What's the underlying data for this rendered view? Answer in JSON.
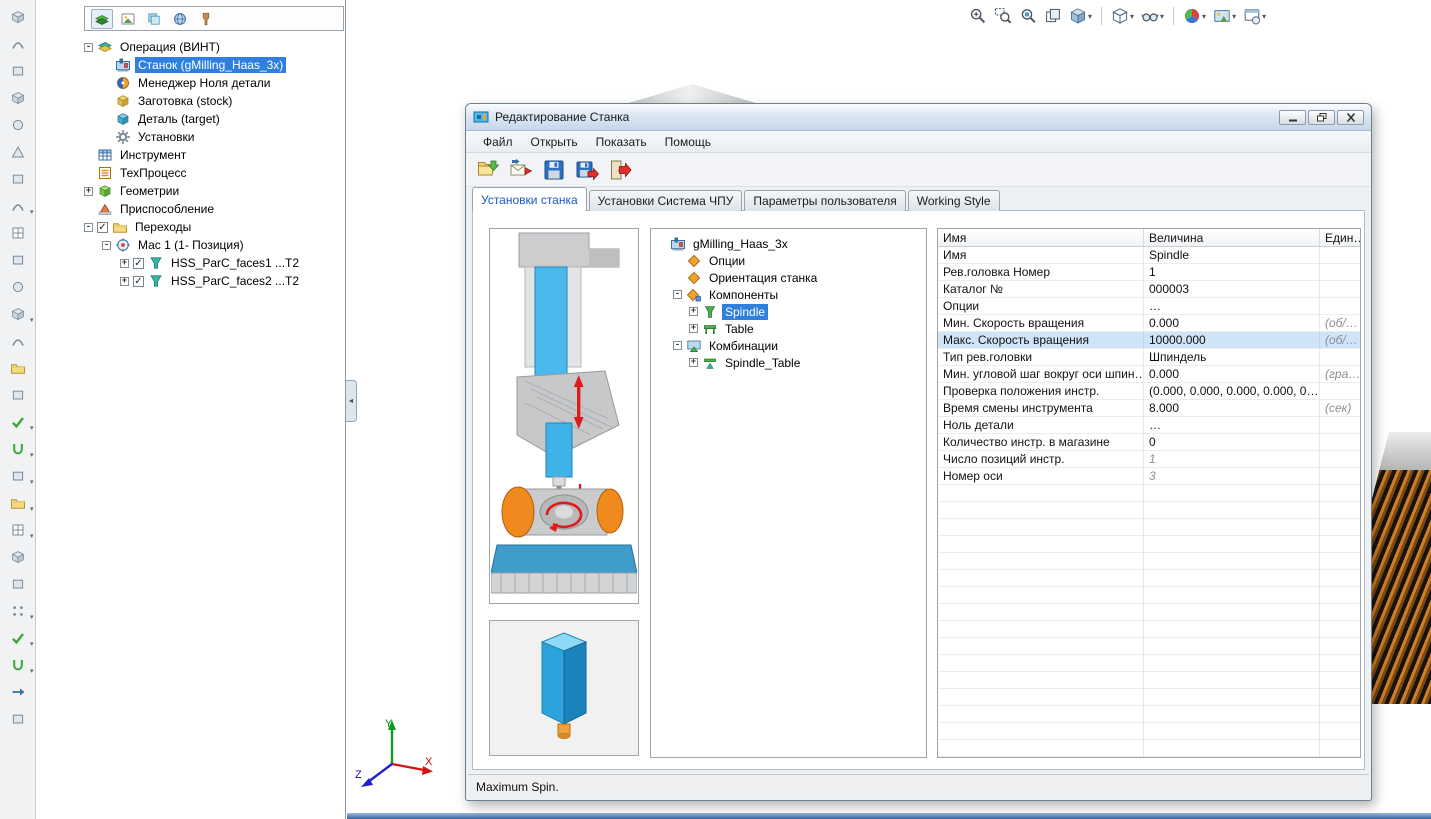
{
  "left_toolbar": {
    "buttons": [
      {
        "icon": "cube"
      },
      {
        "icon": "arc"
      },
      {
        "icon": "rect"
      },
      {
        "icon": "cube"
      },
      {
        "icon": "circle"
      },
      {
        "icon": "tri"
      },
      {
        "icon": "rect"
      },
      {
        "icon": "arc",
        "caret": true
      },
      {
        "icon": "grid"
      },
      {
        "icon": "rect"
      },
      {
        "icon": "circle"
      },
      {
        "icon": "cube",
        "caret": true
      },
      {
        "icon": "arc"
      },
      {
        "icon": "folder"
      },
      {
        "icon": "rect"
      },
      {
        "icon": "check",
        "caret": true
      },
      {
        "icon": "ucurve",
        "caret": true
      },
      {
        "icon": "rect",
        "caret": true
      },
      {
        "icon": "folder",
        "caret": true
      },
      {
        "icon": "grid",
        "caret": true
      },
      {
        "icon": "cube"
      },
      {
        "icon": "rect"
      },
      {
        "icon": "dots",
        "caret": true
      },
      {
        "icon": "check",
        "caret": true
      },
      {
        "icon": "ucurve",
        "caret": true
      },
      {
        "icon": "arrow"
      },
      {
        "icon": "rect"
      }
    ]
  },
  "feature_panel": {
    "tab_icons": [
      "cam-manager",
      "image",
      "layers",
      "globe",
      "paint"
    ],
    "tree": [
      {
        "label": "Операция (ВИНТ)",
        "depth": 0,
        "expand": "minus",
        "icon": "operation"
      },
      {
        "label": "Станок (gMilling_Haas_3x)",
        "depth": 1,
        "icon": "machine",
        "selected": true
      },
      {
        "label": "Менеджер Ноля детали",
        "depth": 1,
        "icon": "zero-manager"
      },
      {
        "label": "Заготовка (stock)",
        "depth": 1,
        "icon": "stock"
      },
      {
        "label": "Деталь (target)",
        "depth": 1,
        "icon": "target"
      },
      {
        "label": "Установки",
        "depth": 1,
        "icon": "settings"
      },
      {
        "label": "Инструмент",
        "depth": 0,
        "icon": "tool"
      },
      {
        "label": "ТехПроцесс",
        "depth": 0,
        "icon": "process"
      },
      {
        "label": "Геометрии",
        "depth": 0,
        "expand": "plus",
        "icon": "geometry"
      },
      {
        "label": "Приспособление",
        "depth": 0,
        "icon": "fixture"
      },
      {
        "label": "Переходы",
        "depth": 0,
        "expand": "minus",
        "checkbox": true,
        "icon": "folder"
      },
      {
        "label": "Мас 1 (1- Позиция)",
        "depth": 1,
        "expand": "minus",
        "icon": "position"
      },
      {
        "label": "HSS_ParC_faces1 ...T2",
        "depth": 2,
        "expand": "plus",
        "checkbox": true,
        "icon": "toolpath"
      },
      {
        "label": "HSS_ParC_faces2 ...T2",
        "depth": 2,
        "expand": "plus",
        "checkbox": true,
        "icon": "toolpath"
      }
    ]
  },
  "hud_toolbar": {
    "buttons": [
      {
        "icon": "zoom-in"
      },
      {
        "icon": "zoom-area"
      },
      {
        "icon": "zoom-selection"
      },
      {
        "icon": "previous-views"
      },
      {
        "icon": "view-orientation",
        "caret": true
      },
      {
        "sep": true
      },
      {
        "icon": "display-style",
        "caret": true
      },
      {
        "icon": "hide-show-items",
        "caret": true
      },
      {
        "sep": true
      },
      {
        "icon": "appearance",
        "caret": true
      },
      {
        "icon": "scene",
        "caret": true
      },
      {
        "icon": "view-settings",
        "caret": true
      }
    ]
  },
  "dialog": {
    "title": "Редактирование Станка",
    "window_buttons": [
      "minimize",
      "restore",
      "close"
    ],
    "menu": [
      "Файл",
      "Открыть",
      "Показать",
      "Помощь"
    ],
    "toolbar": [
      {
        "icon": "open-machine"
      },
      {
        "icon": "import-machine"
      },
      {
        "icon": "save-machine"
      },
      {
        "icon": "save-machine-as"
      },
      {
        "icon": "exit-editor"
      }
    ],
    "tabs": [
      {
        "label": "Установки станка",
        "active": true
      },
      {
        "label": "Установки Система ЧПУ"
      },
      {
        "label": "Параметры пользователя"
      },
      {
        "label": "Working Style"
      }
    ],
    "machine_tree": [
      {
        "label": "gMilling_Haas_3x",
        "depth": 0,
        "icon": "machine"
      },
      {
        "label": "Опции",
        "depth": 1,
        "icon": "diamond"
      },
      {
        "label": "Ориентация станка",
        "depth": 1,
        "icon": "diamond"
      },
      {
        "label": "Компоненты",
        "depth": 1,
        "expand": "minus",
        "icon": "components"
      },
      {
        "label": "Spindle",
        "depth": 2,
        "expand": "plus",
        "icon": "spindle-node",
        "selected": true
      },
      {
        "label": "Table",
        "depth": 2,
        "expand": "plus",
        "icon": "table-node"
      },
      {
        "label": "Комбинации",
        "depth": 1,
        "expand": "minus",
        "icon": "combination"
      },
      {
        "label": "Spindle_Table",
        "depth": 2,
        "expand": "plus",
        "icon": "combination-item"
      }
    ],
    "properties": {
      "columns": [
        "Имя",
        "Величина",
        "Един…"
      ],
      "rows": [
        {
          "name": "Имя",
          "value": "Spindle",
          "unit": ""
        },
        {
          "name": "Рев.головка Номер",
          "value": "1",
          "unit": ""
        },
        {
          "name": "Каталог №",
          "value": "000003",
          "unit": ""
        },
        {
          "name": "Опции",
          "value": "…",
          "unit": ""
        },
        {
          "name": "Мин. Скорость вращения",
          "value": "0.000",
          "unit": "(об/…"
        },
        {
          "name": "Макс. Скорость вращения",
          "value": "10000.000",
          "unit": "(об/…",
          "selected": true
        },
        {
          "name": "Тип рев.головки",
          "value": "Шпиндель",
          "unit": ""
        },
        {
          "name": "Мин. угловой шаг вокруг оси шпин…",
          "value": "0.000",
          "unit": "(гра…"
        },
        {
          "name": "Проверка положения инстр.",
          "value": "(0.000, 0.000, 0.000, 0.000, 0…",
          "unit": ""
        },
        {
          "name": "Время смены инструмента",
          "value": "8.000",
          "unit": "(сек)"
        },
        {
          "name": "Ноль детали",
          "value": "…",
          "unit": ""
        },
        {
          "name": "Количество инстр. в магазине",
          "value": "0",
          "unit": ""
        },
        {
          "name": "Число позиций инстр.",
          "value": "1",
          "unit": "",
          "italic": true
        },
        {
          "name": "Номер оси",
          "value": "3",
          "unit": "",
          "italic": true
        }
      ]
    },
    "status": "Maximum Spin."
  },
  "triad": {
    "x": "X",
    "y": "Y",
    "z": "Z"
  }
}
